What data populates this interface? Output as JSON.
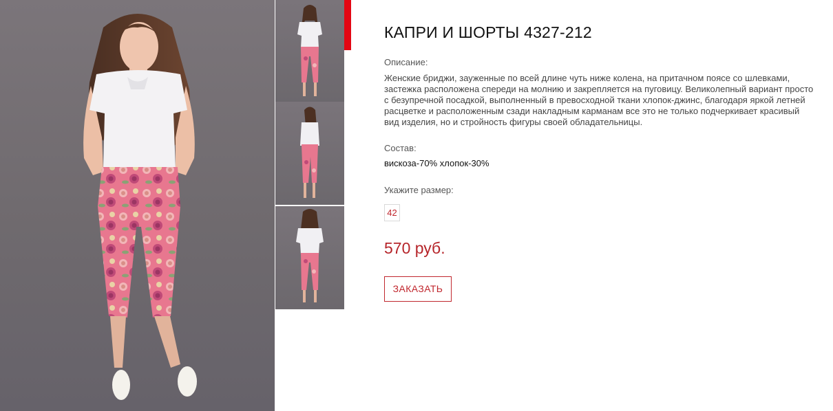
{
  "product": {
    "title": "КАПРИ И ШОРТЫ 4327-212",
    "description_label": "Описание:",
    "description_lines": [
      "Женские бриджи, зауженные по всей длине чуть ниже колена, на притачном поясе со шлевками,",
      "застежка расположена спереди на молнию и закрепляется на пуговицу. Великолепный вариант просто",
      "с безупречной посадкой, выполненный в превосходной ткани хлопок-джинс, благодаря яркой летней",
      "расцветке и расположенным сзади накладным карманам все это не только подчеркивает красивый",
      "вид изделия, но и стройность фигуры своей обладательницы."
    ],
    "composition_label": "Состав:",
    "composition": "вискоза-70% хлопок-30%",
    "size_label": "Укажите размер:",
    "sizes": [
      "42"
    ],
    "price": "570 руб.",
    "order_button": "ЗАКАЗАТЬ"
  },
  "gallery": {
    "main_image": "main-product-photo",
    "thumbnails": [
      "thumb-front",
      "thumb-side",
      "thumb-back"
    ],
    "active_thumbnail": 0
  },
  "colors": {
    "accent": "#e30613",
    "price": "#b6252a",
    "photo_background": "#736e73",
    "pants_pink": "#e8778f",
    "blouse_white": "#f3f2f4"
  }
}
